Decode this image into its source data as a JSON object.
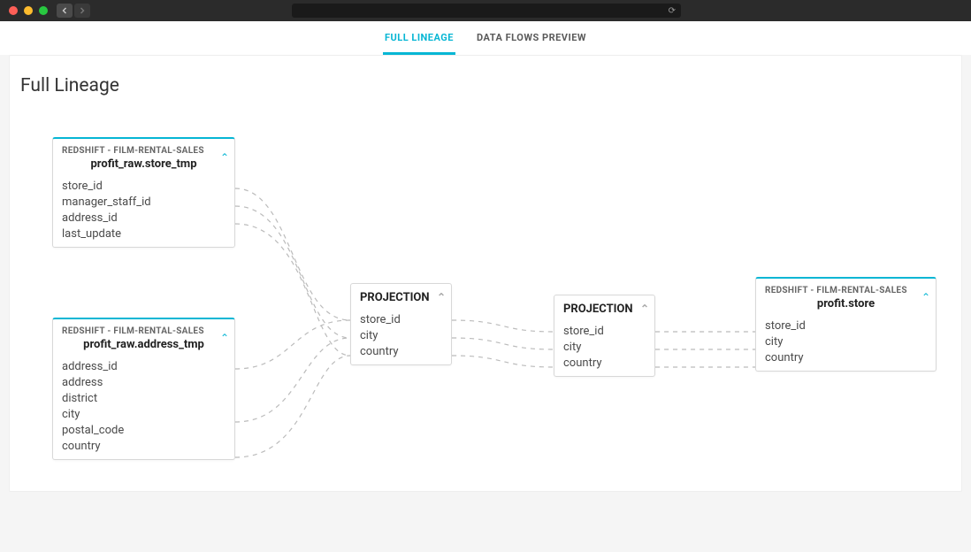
{
  "tabs": {
    "full_lineage": "FULL LINEAGE",
    "data_flows_preview": "DATA FLOWS PREVIEW",
    "active": "full_lineage"
  },
  "page": {
    "title": "Full Lineage"
  },
  "nodes": {
    "store_tmp": {
      "source": "REDSHIFT - FILM-RENTAL-SALES",
      "name": "profit_raw.store_tmp",
      "fields": [
        "store_id",
        "manager_staff_id",
        "address_id",
        "last_update"
      ]
    },
    "address_tmp": {
      "source": "REDSHIFT - FILM-RENTAL-SALES",
      "name": "profit_raw.address_tmp",
      "fields": [
        "address_id",
        "address",
        "district",
        "city",
        "postal_code",
        "country"
      ]
    },
    "projection1": {
      "title": "PROJECTION",
      "fields": [
        "store_id",
        "city",
        "country"
      ]
    },
    "projection2": {
      "title": "PROJECTION",
      "fields": [
        "store_id",
        "city",
        "country"
      ]
    },
    "profit_store": {
      "source": "REDSHIFT - FILM-RENTAL-SALES",
      "name": "profit.store",
      "fields": [
        "store_id",
        "city",
        "country"
      ]
    }
  },
  "colors": {
    "accent": "#06b6d4"
  }
}
